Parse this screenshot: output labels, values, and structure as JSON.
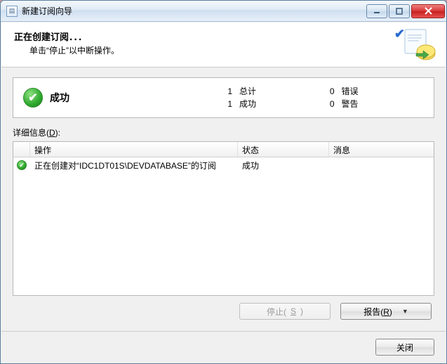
{
  "window": {
    "title": "新建订阅向导"
  },
  "header": {
    "title": "正在创建订阅．．．",
    "subtitle": "单击“停止”以中断操作。"
  },
  "summary": {
    "status_label": "成功",
    "total_count": "1",
    "total_label": "总计",
    "success_count": "1",
    "success_label": "成功",
    "error_count": "0",
    "error_label": "错误",
    "warning_count": "0",
    "warning_label": "警告"
  },
  "details": {
    "label_prefix": "详细信息(",
    "accel": "D",
    "label_suffix": "):",
    "columns": {
      "operation": "操作",
      "status": "状态",
      "message": "消息"
    },
    "rows": [
      {
        "operation": "正在创建对“IDC1DT01S\\DEVDATABASE”的订阅",
        "status": "成功",
        "message": ""
      }
    ]
  },
  "buttons": {
    "stop_prefix": "停止(",
    "stop_accel": "S",
    "stop_suffix": ")",
    "report_prefix": "报告(",
    "report_accel": "R",
    "report_suffix": ")",
    "close": "关闭"
  }
}
